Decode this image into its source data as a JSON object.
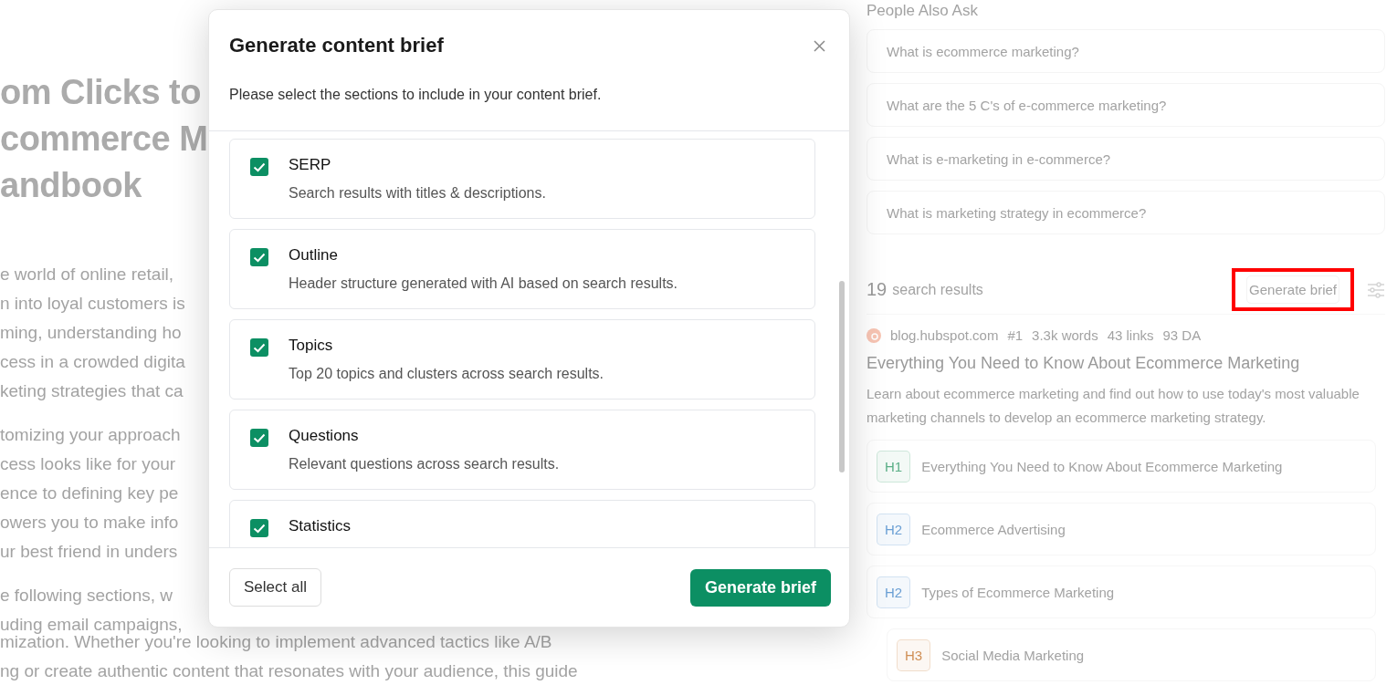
{
  "article": {
    "title_lines": [
      "om Clicks to",
      "commerce M",
      "andbook"
    ],
    "paragraphs": [
      [
        "e world of online retail,",
        "n into loyal customers is",
        "ming, understanding ho",
        "cess in a crowded digita",
        "keting strategies that ca"
      ],
      [
        "tomizing your approach",
        "cess looks like for your",
        "ence to defining key pe",
        "owers you to make info",
        "ur best friend in unders"
      ],
      [
        "e following sections, w",
        "uding email campaigns,"
      ]
    ],
    "tail_lines": [
      "mization. Whether you're looking to implement advanced tactics like A/B",
      "ng or create authentic content that resonates with your audience, this guide"
    ]
  },
  "modal": {
    "title": "Generate content brief",
    "subtitle": "Please select the sections to include in your content brief.",
    "sections": [
      {
        "title": "SERP",
        "description": "Search results with titles & descriptions.",
        "checked": true
      },
      {
        "title": "Outline",
        "description": "Header structure generated with AI based on search results.",
        "checked": true
      },
      {
        "title": "Topics",
        "description": "Top 20 topics and clusters across search results.",
        "checked": true
      },
      {
        "title": "Questions",
        "description": "Relevant questions across search results.",
        "checked": true
      },
      {
        "title": "Statistics",
        "checked": true
      }
    ],
    "secondary_button": "Select all",
    "primary_button": "Generate brief"
  },
  "people_also_ask": {
    "heading": "People Also Ask",
    "questions": [
      "What is ecommerce marketing?",
      "What are the 5 C's of e-commerce marketing?",
      "What is e-marketing in e-commerce?",
      "What is marketing strategy in ecommerce?"
    ]
  },
  "results": {
    "count": "19",
    "label": "search results",
    "button": "Generate brief",
    "highlighted": true,
    "items": [
      {
        "domain": "blog.hubspot.com",
        "stats": [
          "#1",
          "3.3k words",
          "43 links",
          "93 DA"
        ],
        "title": "Everything You Need to Know About Ecommerce Marketing",
        "description": "Learn about ecommerce marketing and find out how to use today's most valuable marketing channels to develop an ecommerce marketing strategy.",
        "outline": [
          {
            "tag": "H1",
            "text": "Everything You Need to Know About Ecommerce Marketing",
            "color": "#5aae86"
          },
          {
            "tag": "H2",
            "text": "Ecommerce Advertising",
            "color": "#6a9fd4"
          },
          {
            "tag": "H2",
            "text": "Types of Ecommerce Marketing",
            "color": "#6a9fd4",
            "children": [
              {
                "tag": "H3",
                "text": "Social Media Marketing",
                "color": "#d08f55"
              }
            ]
          }
        ]
      }
    ]
  }
}
